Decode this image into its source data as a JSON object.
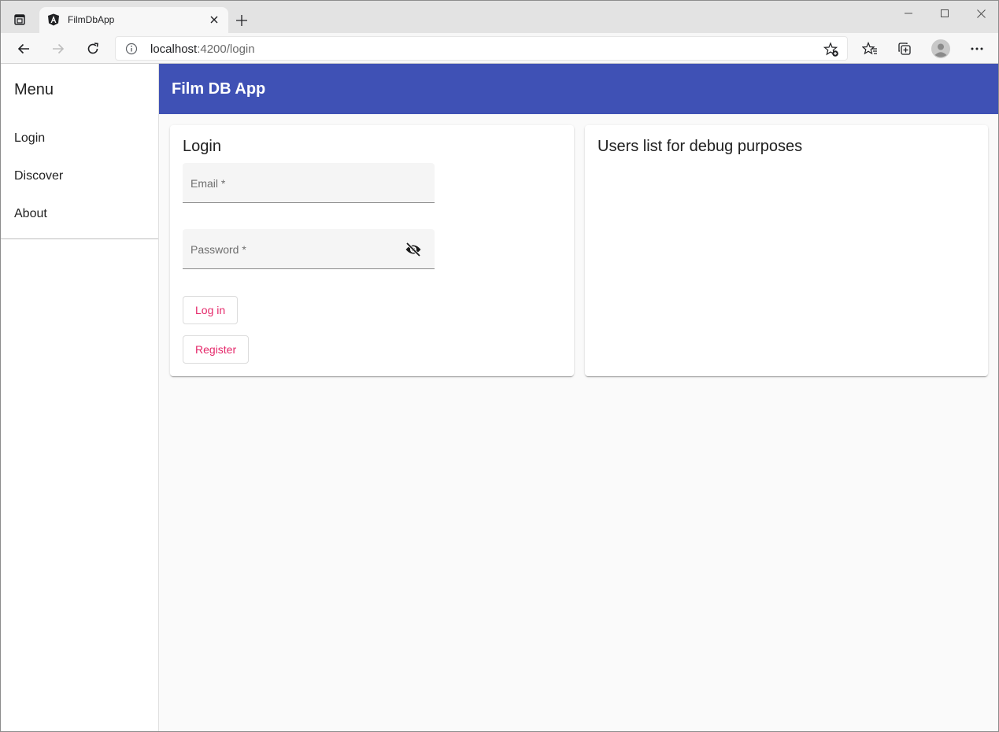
{
  "browser": {
    "tab_title": "FilmDbApp",
    "url_host": "localhost",
    "url_rest": ":4200/login",
    "icons": {
      "tab_actions": "tab-actions-icon",
      "favicon": "angular-icon",
      "tab_close": "close-icon",
      "new_tab": "plus-icon",
      "back": "arrow-left-icon",
      "forward": "arrow-right-icon",
      "refresh": "refresh-icon",
      "info": "info-icon",
      "add_favorite": "star-add-icon",
      "favorites": "favorites-icon",
      "collections": "collections-icon",
      "profile": "profile-icon",
      "more": "more-icon"
    }
  },
  "sidenav": {
    "title": "Menu",
    "items": [
      {
        "label": "Login"
      },
      {
        "label": "Discover"
      },
      {
        "label": "About"
      }
    ]
  },
  "appbar": {
    "title": "Film DB App",
    "color": "#3f51b5"
  },
  "login_card": {
    "title": "Login",
    "email_label": "Email *",
    "password_label": "Password *",
    "login_button": "Log in",
    "register_button": "Register",
    "button_color": "#e5286a"
  },
  "users_card": {
    "title": "Users list for debug purposes"
  }
}
